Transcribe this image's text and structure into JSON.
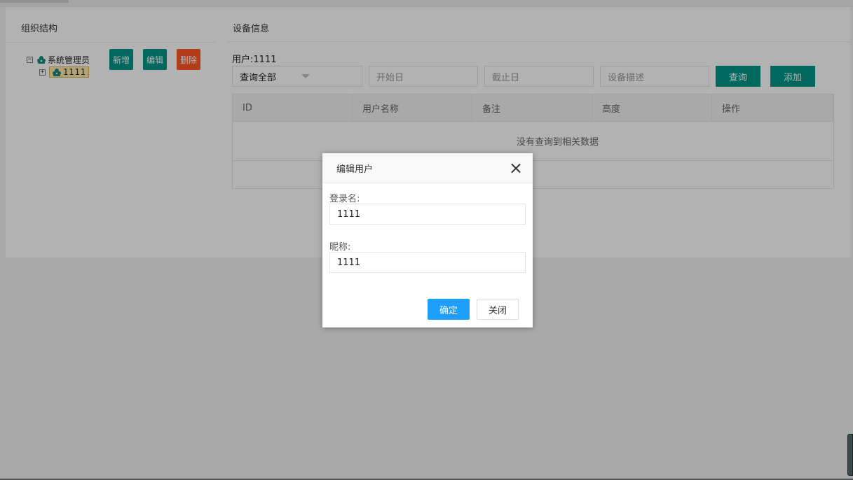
{
  "org_panel": {
    "title": "组织结构",
    "tree": [
      {
        "toggle": "−",
        "label": "系统管理员"
      },
      {
        "toggle": "+",
        "label": "1111"
      }
    ],
    "add_label": "新增",
    "edit_label": "编辑",
    "delete_label": "删除"
  },
  "device_panel": {
    "title": "设备信息",
    "user_label": "用户:1111",
    "select_value": "查询全部",
    "start_placeholder": "开始日",
    "end_placeholder": "截止日",
    "desc_placeholder": "设备描述",
    "query_label": "查询",
    "add_label": "添加",
    "table": {
      "columns": [
        "ID",
        "用户名称",
        "备注",
        "高度",
        "操作"
      ],
      "empty_text": "没有查询到相关数据"
    }
  },
  "dialog": {
    "title": "编辑用户",
    "login_label": "登录名:",
    "login_value": "1111",
    "nickname_label": "昵称:",
    "nickname_value": "1111",
    "ok_label": "确定",
    "close_label": "关闭"
  },
  "colors": {
    "teal": "#009688",
    "red": "#ff5722",
    "blue": "#1e9fff"
  }
}
